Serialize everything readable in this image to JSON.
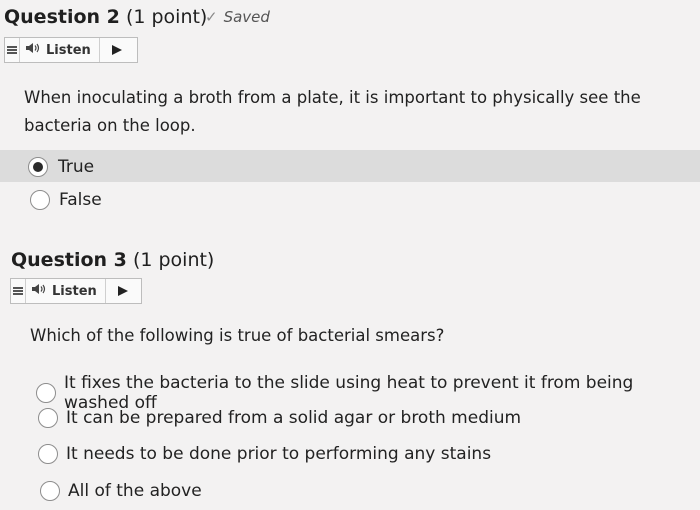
{
  "q2": {
    "title_num": "Question 2",
    "title_pts": "(1 point)",
    "saved_label": "Saved",
    "listen_label": "Listen",
    "text": "When inoculating a broth from a plate, it is important to physically see the bacteria on the loop.",
    "options": [
      {
        "label": "True",
        "selected": true
      },
      {
        "label": "False",
        "selected": false
      }
    ]
  },
  "q3": {
    "title_num": "Question 3",
    "title_pts": "(1 point)",
    "listen_label": "Listen",
    "text": "Which of the following is true of bacterial smears?",
    "options": [
      {
        "label": "It fixes the bacteria to the slide using heat to prevent it from being washed off",
        "selected": false
      },
      {
        "label": "It can be prepared from a solid agar or broth medium",
        "selected": false
      },
      {
        "label": "It needs to be done prior to performing any stains",
        "selected": false
      },
      {
        "label": "All of the above",
        "selected": false
      }
    ]
  },
  "icons": {
    "check": "check-icon",
    "speaker": "speaker-icon",
    "play": "play-icon",
    "menu": "menu-icon"
  }
}
